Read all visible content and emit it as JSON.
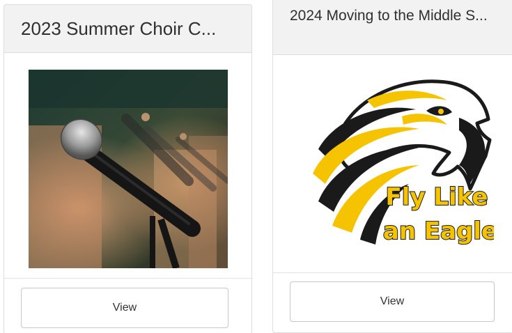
{
  "cards": [
    {
      "title": "2023 Summer Choir C...",
      "image_alt": "microphone-photo",
      "button_label": "View"
    },
    {
      "title": "2024 Moving to the Middle S...",
      "image_alt": "eagle-logo",
      "logo_text_line1": "Fly Like",
      "logo_text_line2": "an Eagle",
      "button_label": "View"
    }
  ],
  "colors": {
    "header_bg": "#f2f2f2",
    "border": "#dcdcdc",
    "eagle_gold": "#f5c300",
    "eagle_black": "#1a1a1a"
  }
}
